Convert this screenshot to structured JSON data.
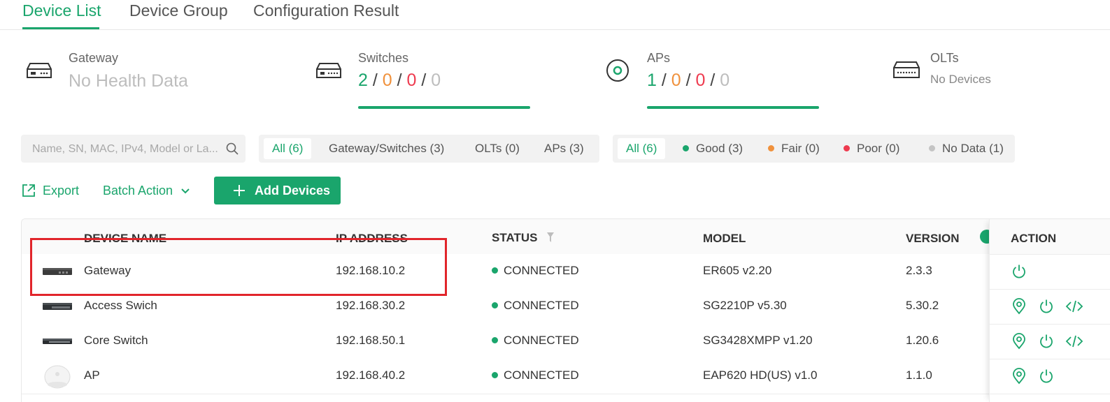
{
  "tabs": [
    {
      "label": "Device List",
      "active": true
    },
    {
      "label": "Device Group",
      "active": false
    },
    {
      "label": "Configuration Result",
      "active": false
    }
  ],
  "stats": {
    "gateway": {
      "title": "Gateway",
      "value": "No Health Data",
      "icon": "gateway-icon"
    },
    "switches": {
      "title": "Switches",
      "good": "2",
      "fair": "0",
      "poor": "0",
      "nodata": "0",
      "sep": "/",
      "icon": "switch-icon"
    },
    "aps": {
      "title": "APs",
      "good": "1",
      "fair": "0",
      "poor": "0",
      "nodata": "0",
      "sep": "/",
      "icon": "ap-icon"
    },
    "olts": {
      "title": "OLTs",
      "value": "No Devices",
      "icon": "olt-icon"
    }
  },
  "search": {
    "placeholder": "Name, SN, MAC, IPv4, Model or La..."
  },
  "type_filter": [
    {
      "label": "All (6)",
      "active": true
    },
    {
      "label": "Gateway/Switches (3)",
      "active": false
    },
    {
      "label": "OLTs (0)",
      "active": false
    },
    {
      "label": "APs (3)",
      "active": false
    }
  ],
  "health_filter": [
    {
      "label": "All (6)",
      "active": true
    },
    {
      "label": "Good (3)",
      "dot": "#1aa56c"
    },
    {
      "label": "Fair (0)",
      "dot": "#f0913c"
    },
    {
      "label": "Poor (0)",
      "dot": "#ee3b4f"
    },
    {
      "label": "No Data (1)",
      "dot": "#c4c4c4"
    }
  ],
  "toolbar": {
    "export_label": "Export",
    "batch_label": "Batch Action",
    "add_label": "Add Devices"
  },
  "table": {
    "columns": {
      "device_name": "DEVICE NAME",
      "ip_address": "IP ADDRESS",
      "status": "STATUS",
      "model": "MODEL",
      "version": "VERSION",
      "action": "ACTION"
    },
    "rows": [
      {
        "name": "Gateway",
        "ip": "192.168.10.2",
        "status": "CONNECTED",
        "model": "ER605 v2.20",
        "version": "2.3.3",
        "device_icon": "gateway-device-image",
        "actions": [
          "power-icon"
        ]
      },
      {
        "name": "Access Swich",
        "ip": "192.168.30.2",
        "status": "CONNECTED",
        "model": "SG2210P v5.30",
        "version": "5.30.2",
        "device_icon": "switch-device-image",
        "actions": [
          "locate-icon",
          "power-icon",
          "cli-icon"
        ]
      },
      {
        "name": "Core Switch",
        "ip": "192.168.50.1",
        "status": "CONNECTED",
        "model": "SG3428XMPP v1.20",
        "version": "1.20.6",
        "device_icon": "switch-device-image",
        "actions": [
          "locate-icon",
          "power-icon",
          "cli-icon"
        ]
      },
      {
        "name": "AP",
        "ip": "192.168.40.2",
        "status": "CONNECTED",
        "model": "EAP620 HD(US) v1.0",
        "version": "1.1.0",
        "device_icon": "ap-device-image",
        "actions": [
          "locate-icon",
          "power-icon"
        ]
      }
    ]
  },
  "colors": {
    "accent": "#1aa56c",
    "fair": "#f0913c",
    "poor": "#ee3b4f",
    "highlight": "#e1252b"
  }
}
